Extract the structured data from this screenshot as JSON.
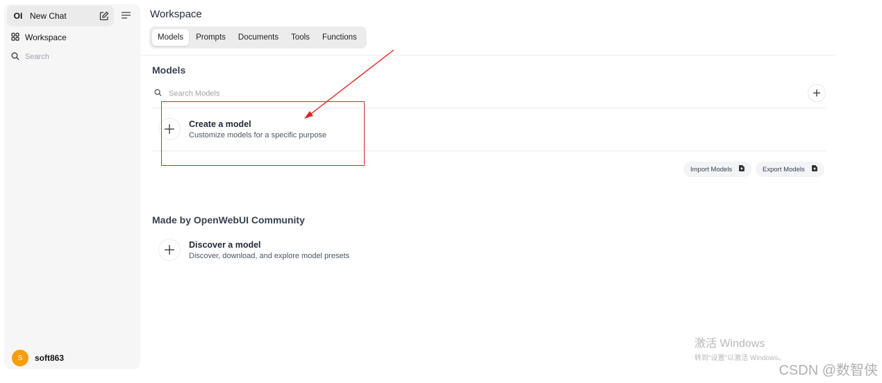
{
  "sidebar": {
    "logo": "OI",
    "new_chat": "New Chat",
    "workspace": "Workspace",
    "search_placeholder": "Search",
    "user": {
      "initial": "S",
      "name": "soft863"
    }
  },
  "header": {
    "title": "Workspace",
    "tabs": [
      "Models",
      "Prompts",
      "Documents",
      "Tools",
      "Functions"
    ],
    "active_tab": "Models"
  },
  "models": {
    "title": "Models",
    "search_placeholder": "Search Models",
    "create": {
      "title": "Create a model",
      "subtitle": "Customize models for a specific purpose"
    },
    "import_label": "Import Models",
    "export_label": "Export Models"
  },
  "community": {
    "title": "Made by OpenWebUI Community",
    "discover": {
      "title": "Discover a model",
      "subtitle": "Discover, download, and explore model presets"
    }
  },
  "watermark": {
    "title": "激活 Windows",
    "subtitle": "转到\"设置\"以激活 Windows。",
    "csdn": "CSDN @数智侠"
  },
  "colors": {
    "annotation": "#e02424",
    "avatar": "#f59e0b"
  }
}
